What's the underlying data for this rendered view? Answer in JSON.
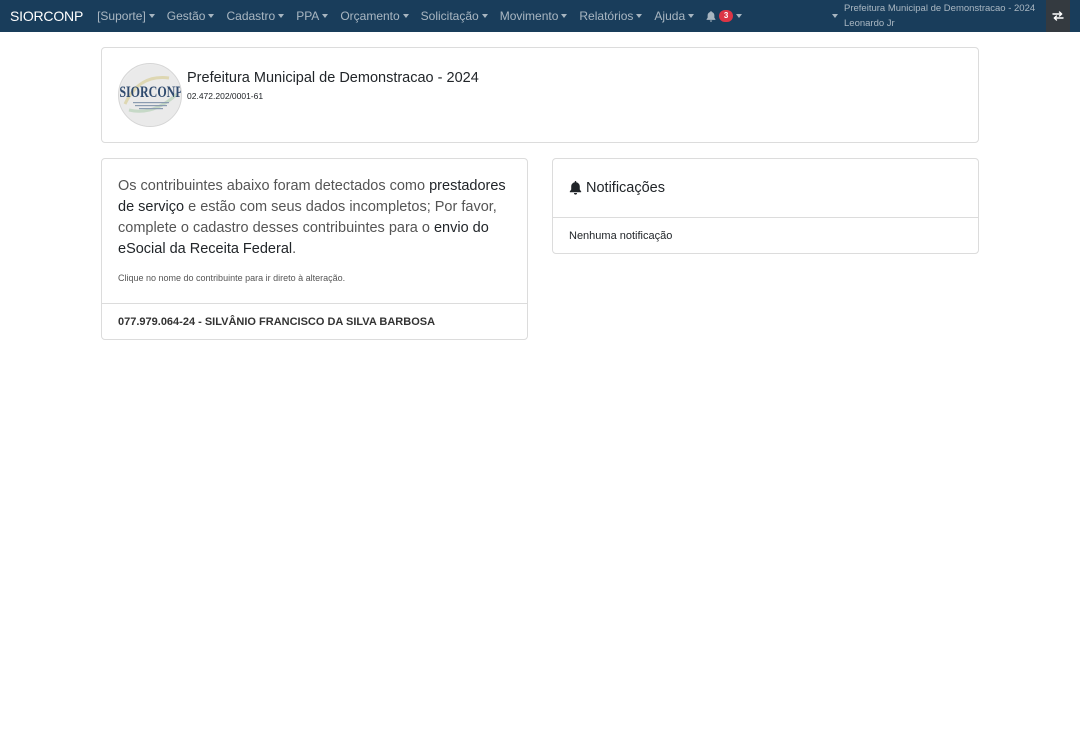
{
  "navbar": {
    "brand": "SIORCONP",
    "menus": [
      {
        "label": "[Suporte]"
      },
      {
        "label": "Gestão"
      },
      {
        "label": "Cadastro"
      },
      {
        "label": "PPA"
      },
      {
        "label": "Orçamento"
      },
      {
        "label": "Solicitação"
      },
      {
        "label": "Movimento"
      },
      {
        "label": "Relatórios"
      },
      {
        "label": "Ajuda"
      }
    ],
    "notifications_count": "3",
    "entity": "Prefeitura Municipal de Demonstracao - 2024",
    "user": "Leonardo Jr",
    "colors": {
      "navbar_bg": "#193d5b",
      "badge": "#dc3545",
      "switch_bg": "#343a40"
    }
  },
  "organization": {
    "logo_text": "SIORCONP",
    "name": "Prefeitura Municipal de Demonstracao - 2024",
    "cnpj": "02.472.202/0001-61"
  },
  "contributors": {
    "lead_1": "Os contribuintes abaixo foram detectados como ",
    "lead_2": "prestadores de serviço",
    "lead_3": " e estão com seus dados incompletos; Por favor, complete o cadastro desses contribuintes para o ",
    "lead_4": "envio do eSocial da Receita Federal",
    "lead_5": ".",
    "hint": "Clique no nome do contribuinte para ir direto à alteração.",
    "items": [
      {
        "label": "077.979.064-24 - SILVÂNIO FRANCISCO DA SILVA BARBOSA"
      }
    ]
  },
  "notifications": {
    "title": "Notificações",
    "empty": "Nenhuma notificação"
  }
}
